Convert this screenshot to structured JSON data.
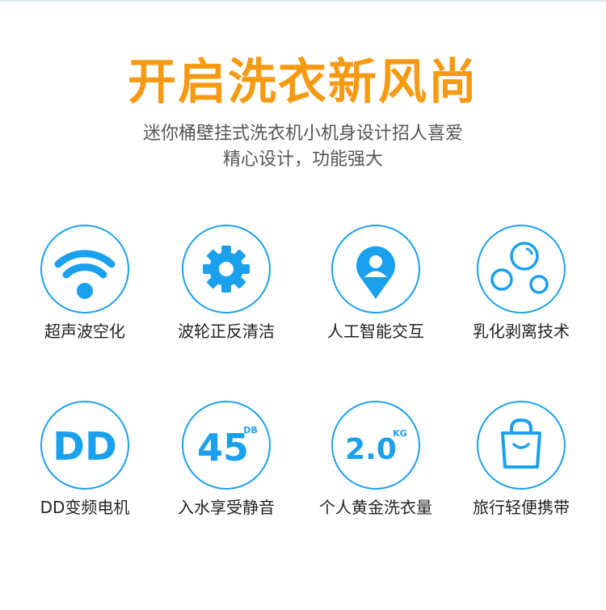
{
  "header": {
    "title": "开启洗衣新风尚",
    "subtitle_line1": "迷你桶壁挂式洗衣机小机身设计招人喜爱",
    "subtitle_line2": "精心设计，功能强大"
  },
  "features": [
    {
      "label": "超声波空化",
      "icon": "wifi-signal-icon"
    },
    {
      "label": "波轮正反清洁",
      "icon": "gear-icon"
    },
    {
      "label": "人工智能交互",
      "icon": "user-location-pin-icon"
    },
    {
      "label": "乳化剥离技术",
      "icon": "bubbles-icon"
    },
    {
      "label": "DD变频电机",
      "icon": "dd-icon",
      "icon_text": "DD"
    },
    {
      "label": "入水享受静音",
      "icon": "decibel-icon",
      "icon_value": "45",
      "icon_unit": "DB"
    },
    {
      "label": "个人黄金洗衣量",
      "icon": "weight-kg-icon",
      "icon_value": "2.0",
      "icon_unit": "KG"
    },
    {
      "label": "旅行轻便携带",
      "icon": "bag-icon"
    }
  ],
  "colors": {
    "accent": "#1ba0ee",
    "title_orange": "#f59a12",
    "text": "#222222",
    "subtitle": "#555555"
  }
}
